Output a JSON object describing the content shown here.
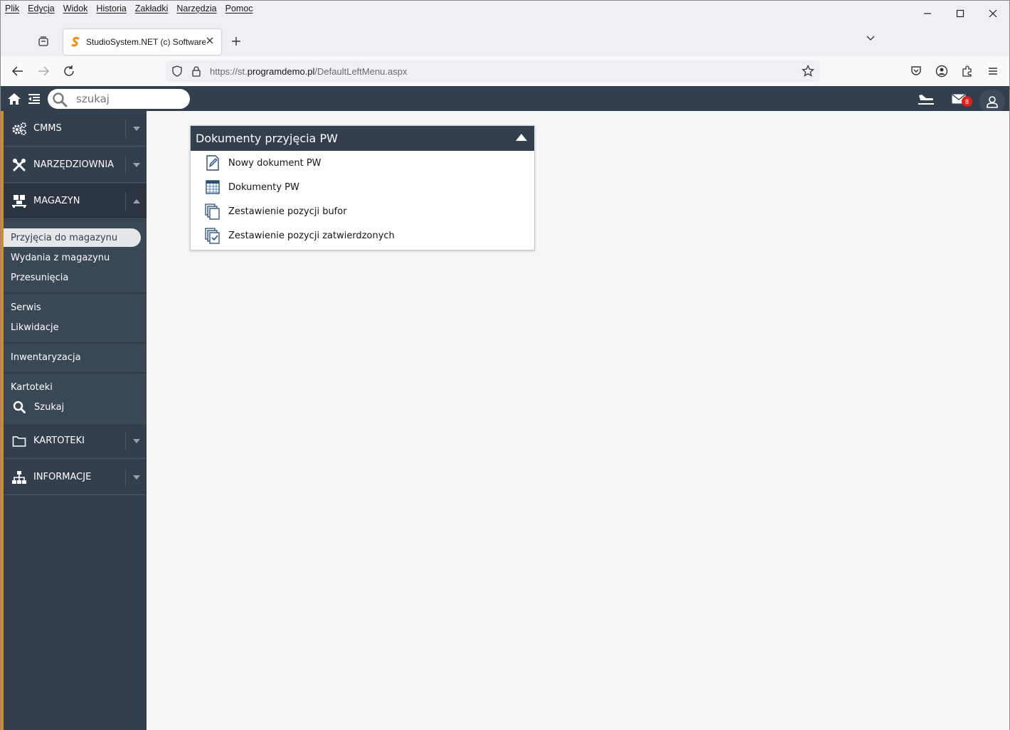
{
  "browser": {
    "menu": [
      "Plik",
      "Edycja",
      "Widok",
      "Historia",
      "Zakładki",
      "Narzędzia",
      "Pomoc"
    ],
    "tab_title": "StudioSystem.NET (c) Software S",
    "url_prefix": "https://st.",
    "url_domain": "programdemo.pl",
    "url_path": "/DefaultLeftMenu.aspx"
  },
  "appbar": {
    "search_placeholder": "szukaj",
    "mail_count": "8"
  },
  "sidebar": {
    "sections": {
      "cmms": "CMMS",
      "narzedziownia": "NARZĘDZIOWNIA",
      "magazyn": "MAGAZYN",
      "kartoteki": "KARTOTEKI",
      "informacje": "INFORMACJE"
    },
    "magazyn_items": {
      "przyjecia": "Przyjęcia do magazynu",
      "wydania": "Wydania z magazynu",
      "przesuniecia": "Przesunięcia",
      "serwis": "Serwis",
      "likwidacje": "Likwidacje",
      "inwentaryzacja": "Inwentaryzacja",
      "kartoteki": "Kartoteki",
      "szukaj": "Szukaj"
    }
  },
  "panel": {
    "title": "Dokumenty przyjęcia PW",
    "items": [
      "Nowy dokument PW",
      "Dokumenty PW",
      "Zestawienie pozycji bufor",
      "Zestawienie pozycji zatwierdzonych"
    ]
  },
  "colors": {
    "app_dark": "#333f4c",
    "accent_orange": "#d48a2a",
    "badge_red": "#e0201c"
  }
}
